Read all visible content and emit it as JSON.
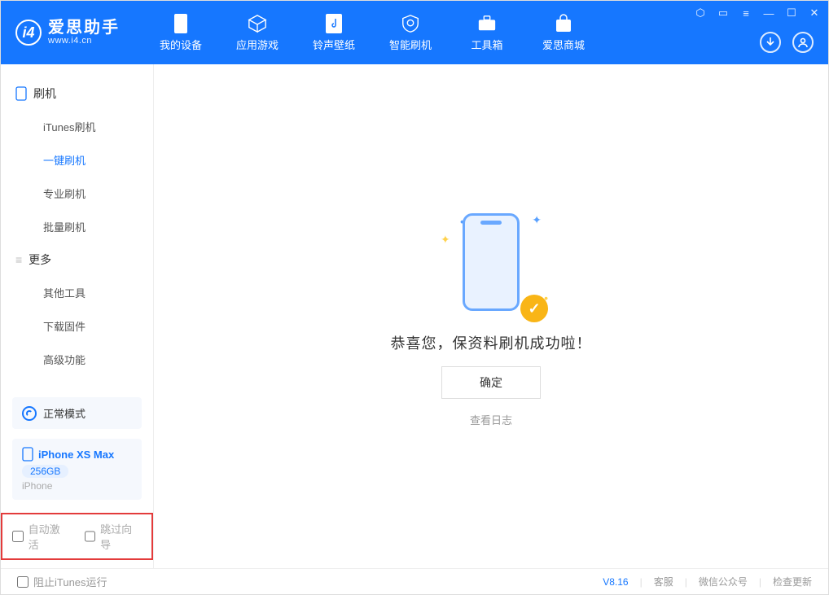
{
  "app": {
    "name": "爱思助手",
    "url": "www.i4.cn"
  },
  "nav": {
    "my_device": "我的设备",
    "apps_games": "应用游戏",
    "ring_wall": "铃声壁纸",
    "smart_flash": "智能刷机",
    "toolbox": "工具箱",
    "store": "爱思商城"
  },
  "sidebar": {
    "group1": "刷机",
    "items1": {
      "itunes": "iTunes刷机",
      "oneclick": "一键刷机",
      "pro": "专业刷机",
      "batch": "批量刷机"
    },
    "group2": "更多",
    "items2": {
      "other": "其他工具",
      "firmware": "下载固件",
      "advanced": "高级功能"
    }
  },
  "mode": {
    "label": "正常模式"
  },
  "device": {
    "name": "iPhone XS Max",
    "storage": "256GB",
    "type": "iPhone"
  },
  "options": {
    "auto_activate": "自动激活",
    "skip_guide": "跳过向导"
  },
  "content": {
    "message": "恭喜您，保资料刷机成功啦！",
    "ok": "确定",
    "log": "查看日志"
  },
  "footer": {
    "block_itunes": "阻止iTunes运行",
    "version": "V8.16",
    "support": "客服",
    "wechat": "微信公众号",
    "update": "检查更新"
  }
}
